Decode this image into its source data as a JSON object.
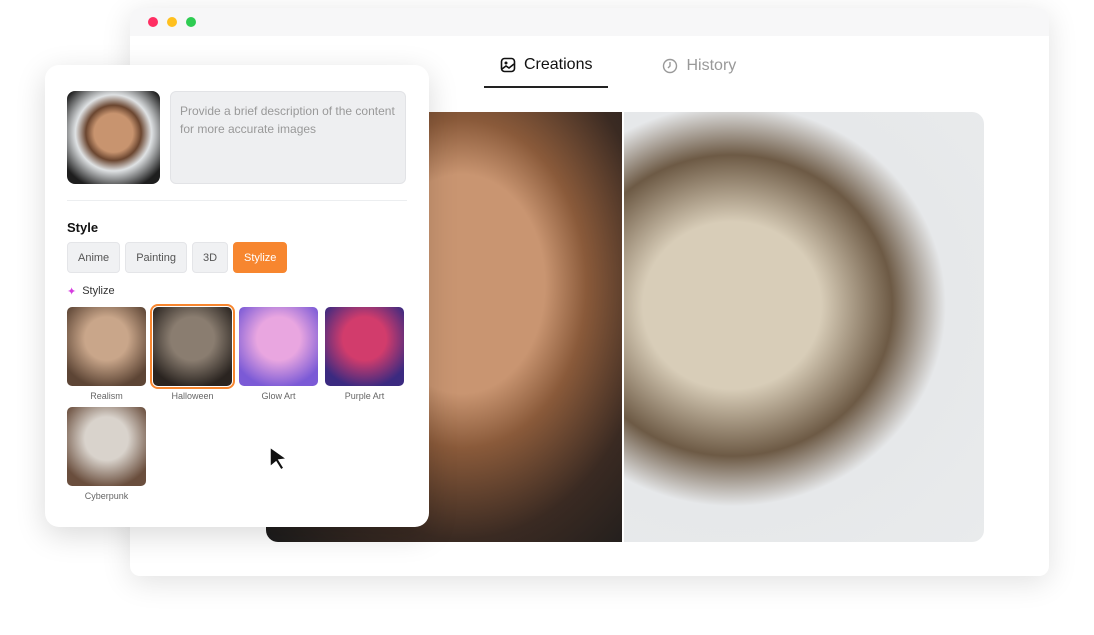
{
  "window": {
    "dots": [
      "#ff5f57",
      "#febc2e",
      "#28c840"
    ]
  },
  "tabs": [
    {
      "label": "Creations",
      "icon": "image-icon",
      "active": true
    },
    {
      "label": "History",
      "icon": "clock-icon",
      "active": false
    }
  ],
  "panel": {
    "description_placeholder": "Provide a brief description of the content for more accurate images",
    "style_title": "Style",
    "style_options": [
      "Anime",
      "Painting",
      "3D",
      "Stylize"
    ],
    "selected_style": "Stylize",
    "subsection_title": "Stylize",
    "presets": [
      {
        "label": "Realism",
        "colors": [
          "#c9a68a",
          "#5d4535"
        ]
      },
      {
        "label": "Halloween",
        "colors": [
          "#8a7d70",
          "#2a2420"
        ],
        "selected": true
      },
      {
        "label": "Glow Art",
        "colors": [
          "#e9a6e0",
          "#7b5ad6"
        ]
      },
      {
        "label": "Purple Art",
        "colors": [
          "#d23c6c",
          "#3b2a80"
        ]
      },
      {
        "label": "Cyberpunk",
        "colors": [
          "#d9d3cc",
          "#6a4e3d"
        ]
      }
    ]
  },
  "colors": {
    "accent": "#f7862f",
    "sparkle": "#d63ce0"
  }
}
